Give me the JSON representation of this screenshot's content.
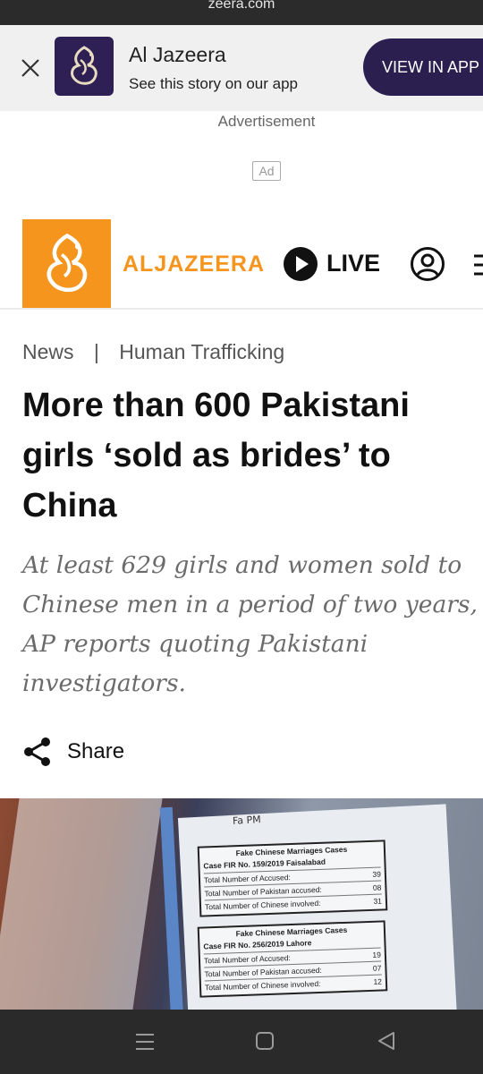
{
  "browser": {
    "url_fragment": "zeera.com"
  },
  "app_banner": {
    "title": "Al Jazeera",
    "subtitle": "See this story on our app",
    "cta_label": "VIEW IN APP",
    "close_icon": "close-icon",
    "logo_icon": "aljazeera-logo-icon"
  },
  "ad": {
    "label": "Advertisement",
    "badge": "Ad"
  },
  "site_header": {
    "wordmark": "ALJAZEERA",
    "live_label": "LIVE",
    "live_icon": "play-circle-icon",
    "account_icon": "account-icon",
    "menu_icon": "menu-icon"
  },
  "breadcrumb": {
    "section": "News",
    "separator": "|",
    "topic": "Human Trafficking"
  },
  "article": {
    "headline": "More than 600 Pakistani girls ‘sold as brides’ to China",
    "standfirst": "At least 629 girls and women sold to Chinese men in a period of two years, AP reports quoting Pakistani investigators.",
    "share_label": "Share",
    "share_icon": "share-icon"
  },
  "photo": {
    "note": "Fa PM",
    "cases": [
      {
        "title": "Fake Chinese Marriages Cases",
        "fir": "Case FIR No. 159/2019 Faisalabad",
        "rows": [
          {
            "label": "Total Number of Accused:",
            "value": "39"
          },
          {
            "label": "Total Number of Pakistan accused:",
            "value": "08"
          },
          {
            "label": "Total Number of Chinese involved:",
            "value": "31"
          }
        ]
      },
      {
        "title": "Fake Chinese Marriages Cases",
        "fir": "Case FIR No. 256/2019 Lahore",
        "rows": [
          {
            "label": "Total Number of Accused:",
            "value": "19"
          },
          {
            "label": "Total Number of Pakistan accused:",
            "value": "07"
          },
          {
            "label": "Total Number of Chinese involved:",
            "value": "12"
          }
        ]
      }
    ]
  },
  "system_nav": {
    "recent_icon": "recent-apps-icon",
    "home_icon": "home-icon",
    "back_icon": "back-icon"
  },
  "colors": {
    "brand_orange": "#f5951e",
    "banner_purple": "#2a1f4f",
    "nav_bar": "#2a2a2a"
  }
}
